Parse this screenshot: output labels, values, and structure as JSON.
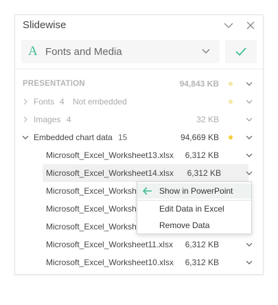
{
  "window": {
    "title": "Slidewise"
  },
  "mode": {
    "label": "Fonts and Media",
    "accent": "#3fbd91"
  },
  "header": {
    "label": "PRESENTATION",
    "size": "94,843 KB"
  },
  "sections": [
    {
      "label": "Fonts",
      "count": "4",
      "note": "Not embedded",
      "size": ""
    },
    {
      "label": "Images",
      "count": "4",
      "note": "",
      "size": "32 KB"
    },
    {
      "label": "Embedded chart data",
      "count": "15",
      "note": "",
      "size": "94,669 KB"
    }
  ],
  "files": [
    {
      "name": "Microsoft_Excel_Worksheet13.xlsx",
      "size": "6,312 KB"
    },
    {
      "name": "Microsoft_Excel_Worksheet14.xlsx",
      "size": "6,312 KB"
    },
    {
      "name": "Microsoft_Excel_Workshe",
      "size": ""
    },
    {
      "name": "Microsoft_Excel_Workshe",
      "size": ""
    },
    {
      "name": "Microsoft_Excel_Workshe",
      "size": ""
    },
    {
      "name": "Microsoft_Excel_Worksheet11.xlsx",
      "size": "6,312 KB"
    },
    {
      "name": "Microsoft_Excel_Worksheet10.xlsx",
      "size": "6,312 KB"
    }
  ],
  "context_menu": {
    "items": [
      "Show in PowerPoint",
      "Edit Data in Excel",
      "Remove Data"
    ]
  },
  "colors": {
    "dot_yellow": "#f2cf3b",
    "dot_pale": "#f6e7a6",
    "accent": "#3fbd91"
  }
}
